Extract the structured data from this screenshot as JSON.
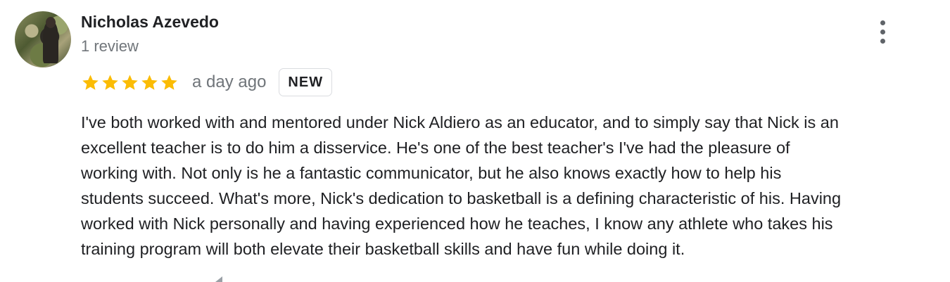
{
  "review": {
    "author_name": "Nicholas Azevedo",
    "review_count": "1 review",
    "rating": 5,
    "rating_max": 5,
    "star_color": "#fbbc04",
    "date": "a day ago",
    "badge": "NEW",
    "text_lines": [
      "I've both worked with and mentored under Nick Aldiero as an educator, and to simply say that Nick is an",
      "excellent teacher is to do him a disservice. He's one of the best teacher's I've had the pleasure of",
      "working with. Not only is he a fantastic communicator, but he also knows exactly how to help his",
      "students succeed. What's more, Nick's dedication to basketball is a defining characteristic of his. Having",
      "worked with Nick personally and having experienced how he teaches, I know any athlete who takes his",
      "training program will both elevate their basketball skills and have fun while doing it."
    ]
  },
  "icons": {
    "menu": "more-vert-icon",
    "star": "star-icon",
    "avatar": "profile-photo"
  }
}
